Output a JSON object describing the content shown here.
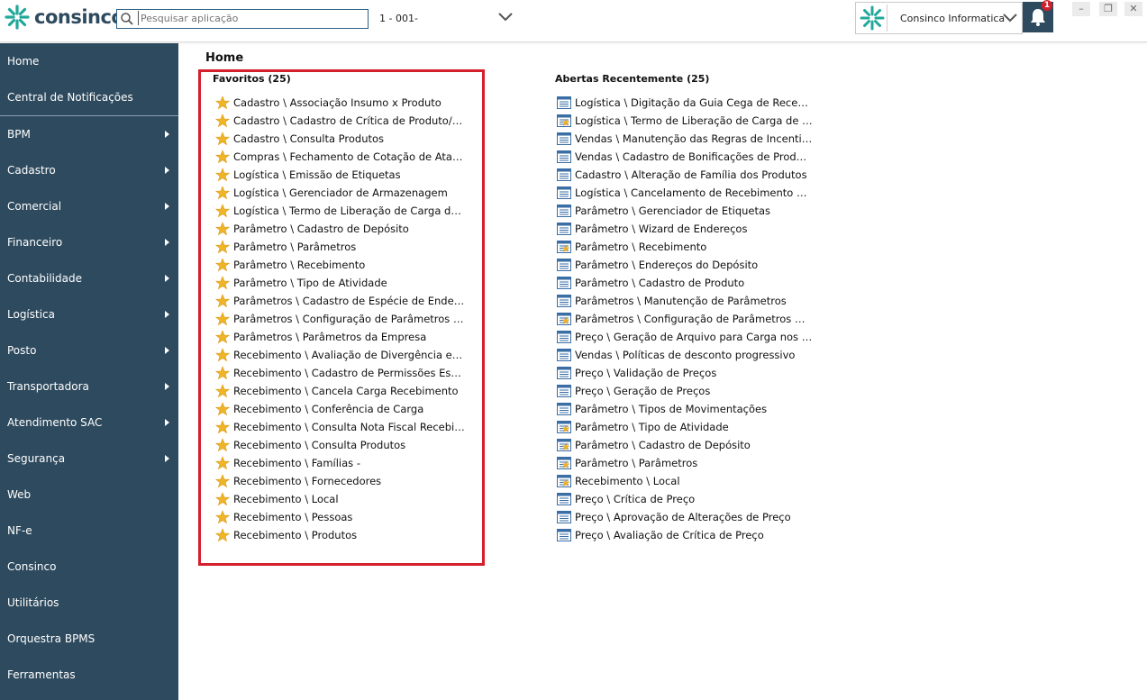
{
  "app": {
    "logo_text": "consinco",
    "search_placeholder": "Pesquisar aplicação",
    "company_code": "1 - 001-",
    "user_name": "Consinco Informatica",
    "notification_count": "1",
    "brand_color": "#2e4a5e",
    "accent_color": "#21a89a",
    "alert_color": "#d0202a"
  },
  "window_controls": {
    "minimize": "–",
    "restore": "❐",
    "close": "✕"
  },
  "sidebar": {
    "items": [
      {
        "label": "Home",
        "has_submenu": false
      },
      {
        "label": "Central de Notificações",
        "has_submenu": false
      },
      {
        "label": "BPM",
        "has_submenu": true
      },
      {
        "label": "Cadastro",
        "has_submenu": true
      },
      {
        "label": "Comercial",
        "has_submenu": true
      },
      {
        "label": "Financeiro",
        "has_submenu": true
      },
      {
        "label": "Contabilidade",
        "has_submenu": true
      },
      {
        "label": "Logística",
        "has_submenu": true
      },
      {
        "label": "Posto",
        "has_submenu": true
      },
      {
        "label": "Transportadora",
        "has_submenu": true
      },
      {
        "label": "Atendimento SAC",
        "has_submenu": true
      },
      {
        "label": "Segurança",
        "has_submenu": true
      },
      {
        "label": "Web",
        "has_submenu": false
      },
      {
        "label": "NF-e",
        "has_submenu": false
      },
      {
        "label": "Consinco",
        "has_submenu": false
      },
      {
        "label": "Utilitários",
        "has_submenu": false
      },
      {
        "label": "Orquestra BPMS",
        "has_submenu": false
      },
      {
        "label": "Ferramentas",
        "has_submenu": false
      }
    ]
  },
  "main": {
    "title": "Home",
    "favorites": {
      "title": "Favoritos (25)",
      "items": [
        "Cadastro \\ Associação Insumo x Produto",
        "Cadastro \\ Cadastro de Crítica de Produto/Fa...",
        "Cadastro \\ Consulta Produtos",
        "Compras \\ Fechamento de Cotação de Atacad...",
        "Logística \\ Emissão de Etiquetas",
        "Logística \\ Gerenciador de Armazenagem",
        "Logística \\ Termo de Liberação de Carga de Re...",
        "Parâmetro \\ Cadastro de Depósito",
        "Parâmetro \\ Parâmetros",
        "Parâmetro \\ Recebimento",
        "Parâmetro \\ Tipo de Atividade",
        "Parâmetros \\ Cadastro de Espécie de Endereço",
        "Parâmetros \\ Configuração de Parâmetros Din...",
        "Parâmetros \\ Parâmetros da Empresa",
        "Recebimento \\ Avaliação de Divergência ente ...",
        "Recebimento \\ Cadastro de Permissões Especi...",
        "Recebimento \\ Cancela Carga Recebimento",
        "Recebimento \\ Conferência de Carga",
        "Recebimento \\ Consulta Nota Fiscal Recebida",
        "Recebimento \\ Consulta Produtos",
        "Recebimento \\ Famílias -",
        "Recebimento \\ Fornecedores",
        "Recebimento \\ Local",
        "Recebimento \\ Pessoas",
        "Recebimento \\ Produtos"
      ]
    },
    "recent": {
      "title": "Abertas Recentemente (25)",
      "items": [
        {
          "label": "Logística \\ Digitação da Guia Cega de Recebi...",
          "icon": "window-icon"
        },
        {
          "label": "Logística \\ Termo de Liberação de Carga de Re...",
          "icon": "window-star-icon"
        },
        {
          "label": "Vendas \\ Manutenção das Regras de Incentivo",
          "icon": "window-icon"
        },
        {
          "label": "Vendas \\ Cadastro de Bonificações de Produtos",
          "icon": "window-icon"
        },
        {
          "label": "Cadastro \\ Alteração de Família dos Produtos",
          "icon": "window-icon"
        },
        {
          "label": "Logística \\ Cancelamento de Recebimento de ...",
          "icon": "window-icon"
        },
        {
          "label": "Parâmetro \\ Gerenciador de Etiquetas",
          "icon": "window-icon"
        },
        {
          "label": "Parâmetro \\ Wizard de Endereços",
          "icon": "window-icon"
        },
        {
          "label": "Parâmetro \\ Recebimento",
          "icon": "window-star-icon"
        },
        {
          "label": "Parâmetro \\ Endereços do Depósito",
          "icon": "window-icon"
        },
        {
          "label": "Parâmetro \\ Cadastro de Produto",
          "icon": "window-icon"
        },
        {
          "label": "Parâmetros \\ Manutenção de Parâmetros",
          "icon": "window-icon"
        },
        {
          "label": "Parâmetros \\ Configuração de Parâmetros Din...",
          "icon": "window-star-icon"
        },
        {
          "label": "Preço \\ Geração de Arquivo para Carga nos PD...",
          "icon": "window-icon"
        },
        {
          "label": "Vendas \\ Políticas de desconto progressivo",
          "icon": "window-icon"
        },
        {
          "label": "Preço \\ Validação de Preços",
          "icon": "window-icon"
        },
        {
          "label": "Preço \\ Geração de Preços",
          "icon": "window-icon"
        },
        {
          "label": "Parâmetro \\ Tipos de Movimentações",
          "icon": "window-icon"
        },
        {
          "label": "Parâmetro \\ Tipo de Atividade",
          "icon": "window-star-icon"
        },
        {
          "label": "Parâmetro \\ Cadastro de Depósito",
          "icon": "window-star-icon"
        },
        {
          "label": "Parâmetro \\ Parâmetros",
          "icon": "window-star-icon"
        },
        {
          "label": "Recebimento \\ Local",
          "icon": "window-star-icon"
        },
        {
          "label": "Preço \\ Crítica de Preço",
          "icon": "window-icon"
        },
        {
          "label": "Preço \\ Aprovação de Alterações de Preço",
          "icon": "window-icon"
        },
        {
          "label": "Preço \\ Avaliação de Crítica de Preço",
          "icon": "window-icon"
        }
      ]
    }
  }
}
